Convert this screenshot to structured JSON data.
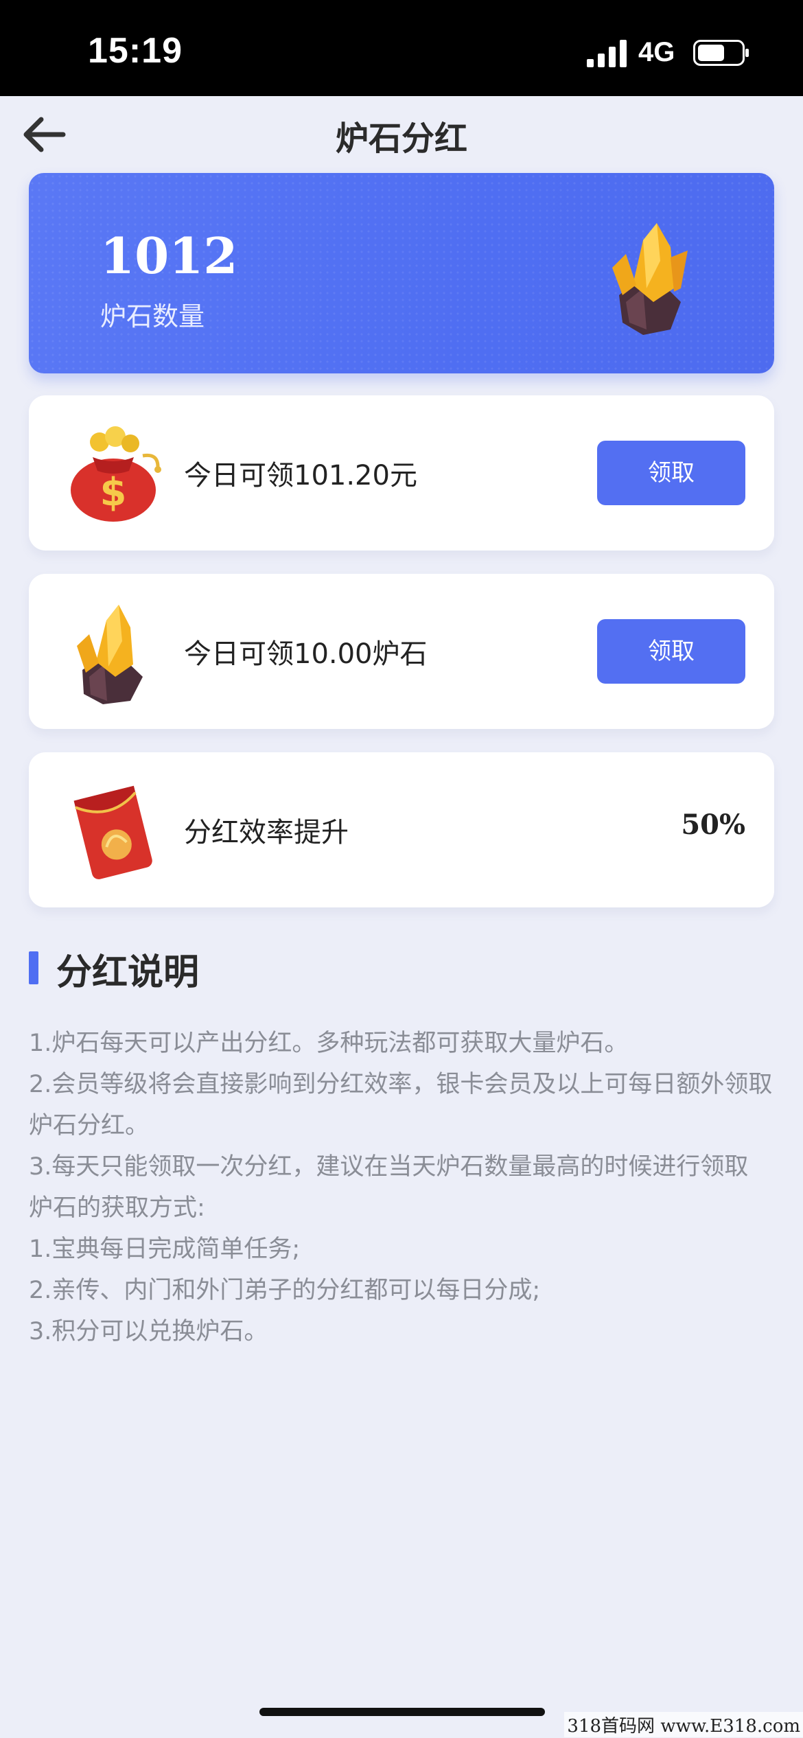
{
  "status_bar": {
    "time": "15:19",
    "network": "4G"
  },
  "nav": {
    "title": "炉石分红"
  },
  "hero": {
    "count": "1012",
    "label": "炉石数量"
  },
  "cards": [
    {
      "text": "今日可领101.20元",
      "button": "领取",
      "icon": "money-bag-icon"
    },
    {
      "text": "今日可领10.00炉石",
      "button": "领取",
      "icon": "crystal-icon"
    },
    {
      "text": "分红效率提升",
      "value": "50%",
      "icon": "red-envelope-icon"
    }
  ],
  "section": {
    "title": "分红说明",
    "lines": [
      "1.炉石每天可以产出分红。多种玩法都可获取大量炉石。",
      "2.会员等级将会直接影响到分红效率，银卡会员及以上可每日额外领取炉石分红。",
      "3.每天只能领取一次分红，建议在当天炉石数量最高的时候进行领取",
      "炉石的获取方式:",
      "1.宝典每日完成简单任务;",
      "2.亲传、内门和外门弟子的分红都可以每日分成;",
      "3.积分可以兑换炉石。"
    ]
  },
  "watermark": "318首码网 www.E318.com",
  "colors": {
    "accent": "#536ff2",
    "background": "#eceef8"
  }
}
